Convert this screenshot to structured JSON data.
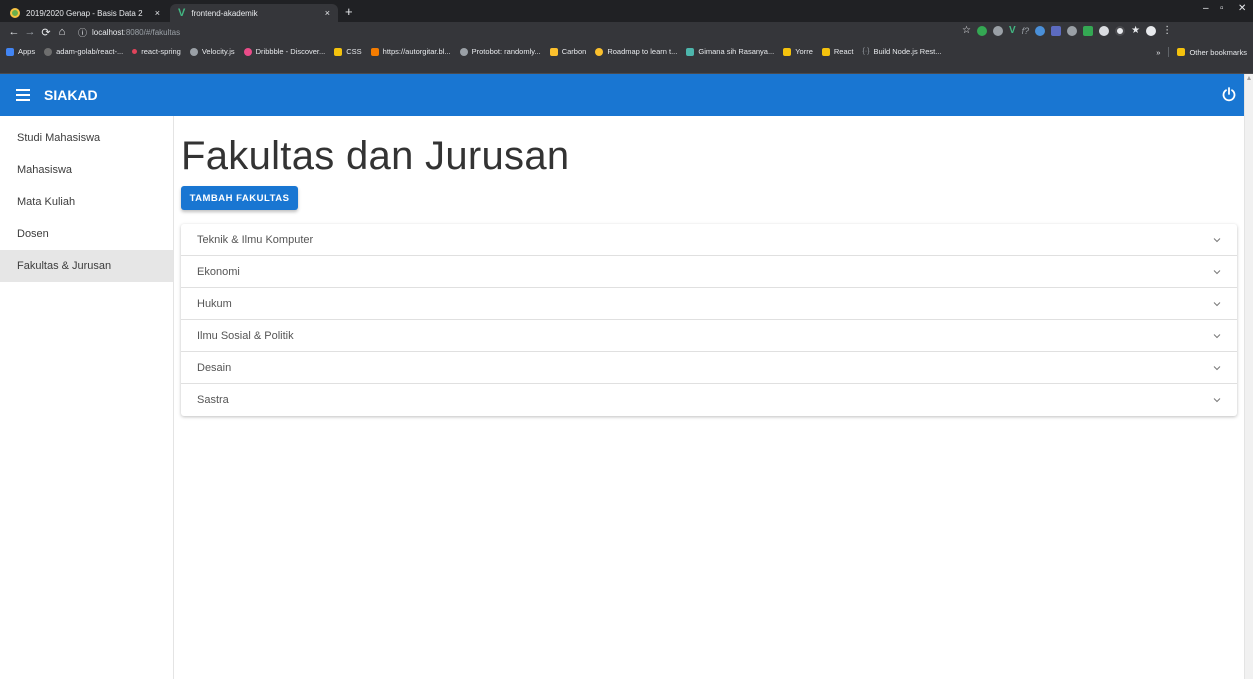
{
  "browser": {
    "tabs": [
      {
        "title": "2019/2020 Genap - Basis Data 2",
        "close": "×"
      },
      {
        "title": "frontend-akademik",
        "close": "×"
      }
    ],
    "new_tab": "+",
    "window": {
      "minimize": "–",
      "maximize": "▫",
      "close": "✕"
    },
    "address": {
      "host": "localhost",
      "path": ":8080/#/fakultas"
    },
    "bookmarks": [
      {
        "label": "Apps",
        "color": "#4285f4"
      },
      {
        "label": "adam-golab/react-...",
        "color": "#6e6e6e"
      },
      {
        "label": "react-spring",
        "color": "#e0445b"
      },
      {
        "label": "Velocity.js",
        "color": "#9aa0a6"
      },
      {
        "label": "Dribbble - Discover...",
        "color": "#ea4c89"
      },
      {
        "label": "CSS",
        "color": "#f4c20d"
      },
      {
        "label": "https://autorgitar.bl...",
        "color": "#f57c00"
      },
      {
        "label": "Protobot: randomly...",
        "color": "#9aa0a6"
      },
      {
        "label": "Carbon",
        "color": "#fbc02d"
      },
      {
        "label": "Roadmap to learn t...",
        "color": "#fbc02d"
      },
      {
        "label": "Gimana sih Rasanya...",
        "color": "#4db6ac"
      },
      {
        "label": "Yorre",
        "color": "#f4c20d"
      },
      {
        "label": "React",
        "color": "#f4c20d"
      },
      {
        "label": "Build Node.js Rest...",
        "color": "#9aa0a6"
      }
    ],
    "bookmarks_more": "»",
    "other_bookmarks": "Other bookmarks"
  },
  "app": {
    "brand": "SIAKAD",
    "primary_color": "#1976d2"
  },
  "sidebar": {
    "items": [
      {
        "label": "Studi Mahasiswa"
      },
      {
        "label": "Mahasiswa"
      },
      {
        "label": "Mata Kuliah"
      },
      {
        "label": "Dosen"
      },
      {
        "label": "Fakultas & Jurusan",
        "active": true
      }
    ]
  },
  "main": {
    "title": "Fakultas dan Jurusan",
    "add_button": "TAMBAH FAKULTAS",
    "faculties": [
      {
        "name": "Teknik & Ilmu Komputer"
      },
      {
        "name": "Ekonomi"
      },
      {
        "name": "Hukum"
      },
      {
        "name": "Ilmu Sosial & Politik"
      },
      {
        "name": "Desain"
      },
      {
        "name": "Sastra"
      }
    ]
  }
}
